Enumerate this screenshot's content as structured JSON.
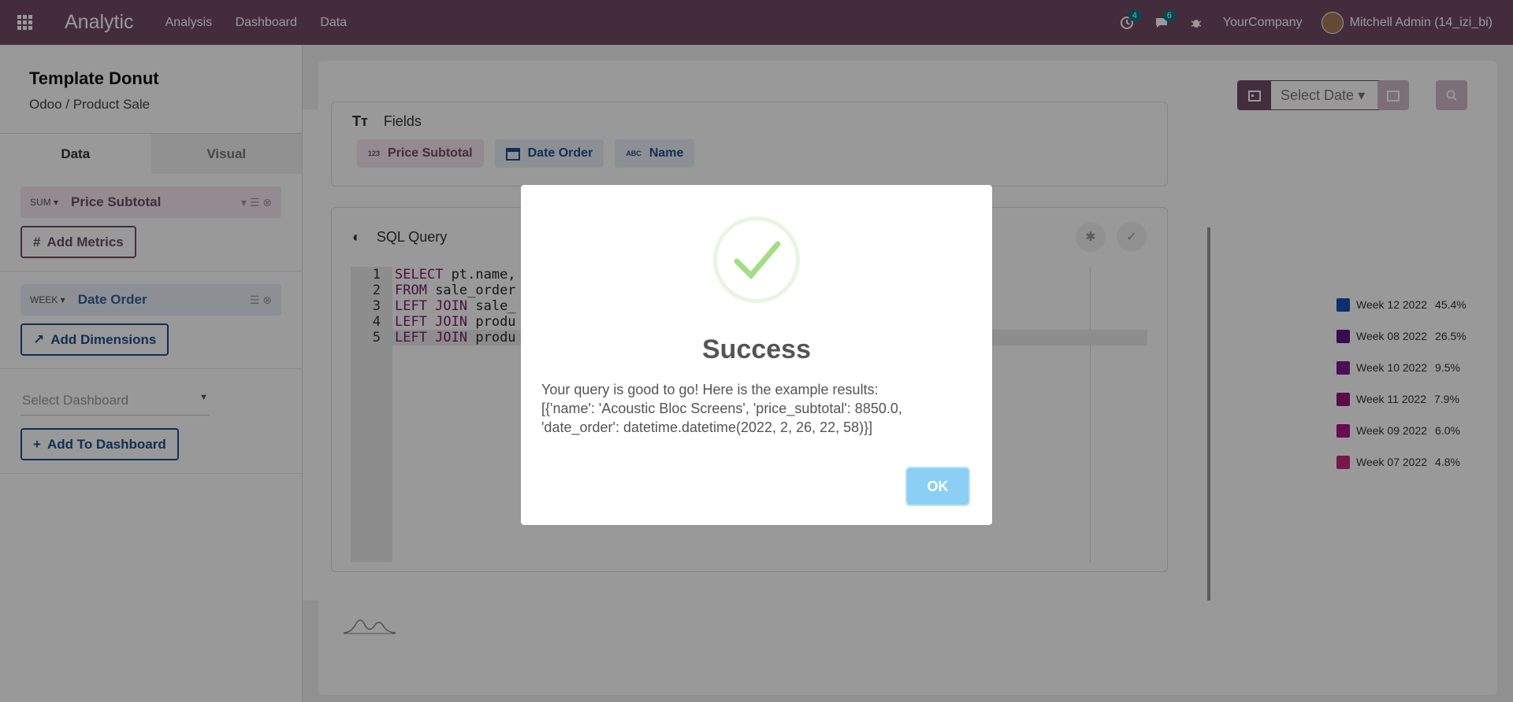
{
  "navbar": {
    "brand": "Analytic",
    "menu": [
      "Analysis",
      "Dashboard",
      "Data"
    ],
    "activity_count": "4",
    "message_count": "6",
    "company": "YourCompany",
    "user": "Mitchell Admin (14_izi_bi)"
  },
  "left_panel": {
    "title": "Template Donut",
    "subtitle": "Odoo / Product Sale",
    "tabs": [
      "Data",
      "Visual"
    ],
    "metric": {
      "agg": "SUM",
      "field": "Price Subtotal"
    },
    "add_metrics": "Add Metrics",
    "dimension": {
      "agg": "WEEK",
      "field": "Date Order"
    },
    "add_dimensions": "Add Dimensions",
    "select_dashboard_placeholder": "Select Dashboard",
    "add_to_dashboard": "Add To Dashboard"
  },
  "main": {
    "date_select": "Select Date",
    "legend": [
      {
        "label": "Week 12 2022",
        "pct": "45.4%",
        "color": "#1550b8"
      },
      {
        "label": "Week 08 2022",
        "pct": "26.5%",
        "color": "#5a1785"
      },
      {
        "label": "Week 10 2022",
        "pct": "9.5%",
        "color": "#7c1a8f"
      },
      {
        "label": "Week 11 2022",
        "pct": "7.9%",
        "color": "#951670"
      },
      {
        "label": "Week 09 2022",
        "pct": "6.0%",
        "color": "#b0128e"
      },
      {
        "label": "Week 07 2022",
        "pct": "4.8%",
        "color": "#c8287a"
      }
    ]
  },
  "editor": {
    "fields_label": "Fields",
    "fields": [
      {
        "type": "123",
        "name": "Price Subtotal"
      },
      {
        "type": "date",
        "name": "Date Order"
      },
      {
        "type": "ABC",
        "name": "Name"
      }
    ],
    "sql_label": "SQL Query",
    "code_lines": [
      {
        "n": "1",
        "kw": "SELECT",
        "rest": " pt.name,"
      },
      {
        "n": "2",
        "kw": "FROM",
        "rest": " sale_order"
      },
      {
        "n": "3",
        "kw": "LEFT JOIN",
        "rest": " sale_"
      },
      {
        "n": "4",
        "kw": "LEFT JOIN",
        "rest": " produ"
      },
      {
        "n": "5",
        "kw": "LEFT JOIN",
        "rest": " produ"
      }
    ]
  },
  "modal": {
    "title": "Success",
    "line1": "Your query is good to go! Here is the example results:",
    "line2": "[{'name': 'Acoustic Bloc Screens', 'price_subtotal': 8850.0,",
    "line3": "'date_order': datetime.datetime(2022, 2, 26, 22, 58)}]",
    "ok": "OK"
  }
}
